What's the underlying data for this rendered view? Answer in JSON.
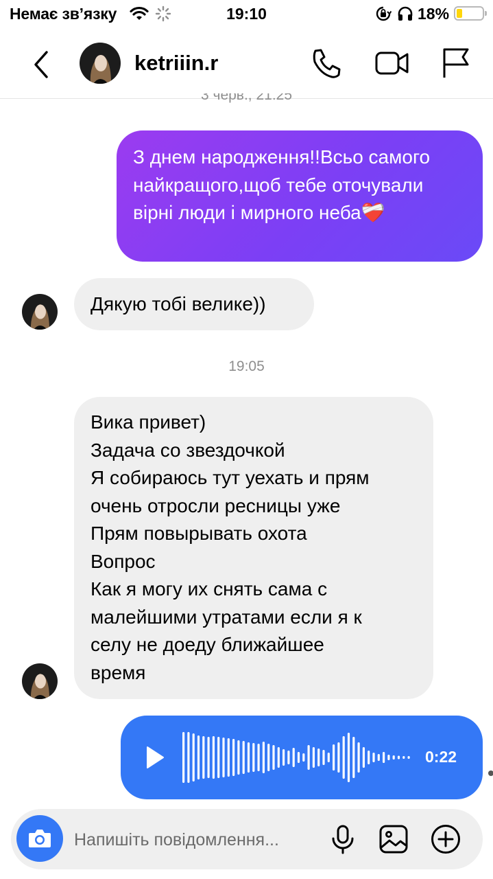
{
  "status_bar": {
    "carrier": "Немає зв’язку",
    "time": "19:10",
    "battery_percent": "18%",
    "battery_level": 0.18,
    "battery_color": "#ffd60a"
  },
  "header": {
    "contact_name": "ketriiin.r",
    "icons": [
      "back-chevron-icon",
      "phone-icon",
      "video-camera-icon",
      "flag-icon"
    ]
  },
  "chat": {
    "timestamp_top_cut": "3 черв., 21:25",
    "message_sent": "З днем народження!!Всьо самого найкращого,щоб тебе оточували вірні люди і мирного неба❤️‍🩹",
    "message_in_1": "Дякую тобі велике))",
    "timestamp_2": "19:05",
    "message_in_2_lines": [
      "Вика привет)",
      "Задача со звездочкой",
      "Я собираюсь тут уехать и прям",
      "очень отросли ресницы уже",
      "Прям повырывать охота",
      "Вопрос",
      "Как я могу их снять сама с",
      "малейшими утратами если я к",
      "селу не доеду ближайшее",
      "время"
    ],
    "voice_message": {
      "duration": "0:22",
      "color": "#3478f6"
    },
    "sent_gradient": [
      "#9b3cf0",
      "#6a4af7"
    ]
  },
  "composer": {
    "placeholder": "Напишіть повідомлення...",
    "icons": [
      "camera-icon",
      "microphone-icon",
      "gallery-icon",
      "add-icon"
    ],
    "accent": "#3478f6"
  }
}
